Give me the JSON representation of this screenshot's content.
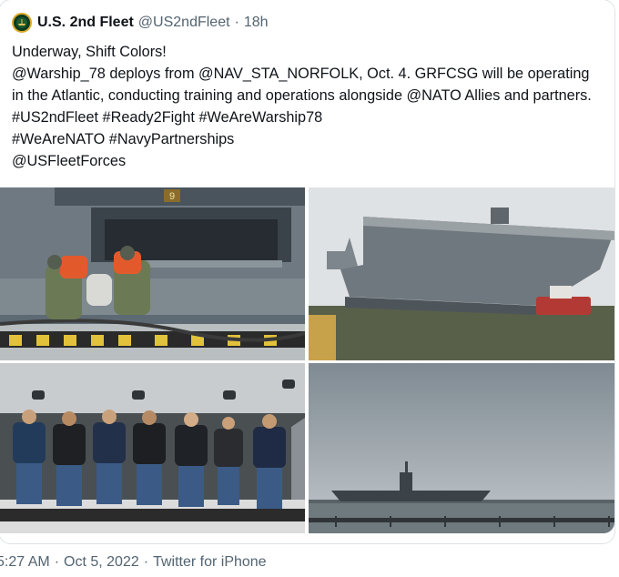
{
  "account": {
    "name": "U.S. 2nd Fleet",
    "handle": "@US2ndFleet",
    "separator": "·",
    "relative_time": "18h"
  },
  "tweet": {
    "text": "Underway, Shift Colors!\n@Warship_78 deploys from @NAV_STA_NORFOLK, Oct. 4. GRFCSG will be operating in the Atlantic, conducting training and operations alongside @NATO Allies and partners. #US2ndFleet #Ready2Fight #WeAreWarship78\n#WeAreNATO #NavyPartnerships\n@USFleetForces"
  },
  "photos": [
    {
      "name": "photo-sailors-handling-line",
      "hull_number": "9"
    },
    {
      "name": "photo-carrier-departing-pier"
    },
    {
      "name": "photo-crew-lineup-hangar"
    },
    {
      "name": "photo-carrier-at-sea"
    }
  ],
  "footer": {
    "time": "5:27 AM",
    "date": "Oct 5, 2022",
    "source": "Twitter for iPhone",
    "separator": "·"
  },
  "colors": {
    "text": "#0f1419",
    "secondary_text": "#536471",
    "border": "#dfe3e6"
  }
}
